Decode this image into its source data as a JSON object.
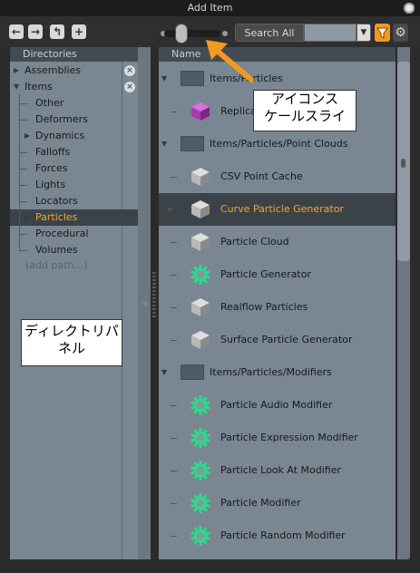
{
  "window": {
    "title": "Add Item"
  },
  "toolbar": {
    "back_icon": "arrow-left",
    "forward_icon": "arrow-right",
    "up_icon": "up-level",
    "add_icon": "plus",
    "search_mode": "Search All",
    "search_value": "",
    "dropdown_icon": "chevron-down",
    "filter_icon": "filter",
    "gear_icon": "gear",
    "filter_color": "#f29a1f"
  },
  "directories": {
    "header": "Directories",
    "items": [
      {
        "label": "Assemblies",
        "level": 0,
        "expander": "collapsed",
        "removable": true,
        "selected": false
      },
      {
        "label": "Items",
        "level": 0,
        "expander": "expanded",
        "removable": true,
        "selected": false
      },
      {
        "label": "Other",
        "level": 1,
        "expander": "none",
        "selected": false
      },
      {
        "label": "Deformers",
        "level": 1,
        "expander": "none",
        "selected": false
      },
      {
        "label": "Dynamics",
        "level": 1,
        "expander": "collapsed",
        "selected": false
      },
      {
        "label": "Falloffs",
        "level": 1,
        "expander": "none",
        "selected": false
      },
      {
        "label": "Forces",
        "level": 1,
        "expander": "none",
        "selected": false
      },
      {
        "label": "Lights",
        "level": 1,
        "expander": "none",
        "selected": false
      },
      {
        "label": "Locators",
        "level": 1,
        "expander": "none",
        "selected": false
      },
      {
        "label": "Particles",
        "level": 1,
        "expander": "collapsed",
        "selected": true
      },
      {
        "label": "Procedural",
        "level": 1,
        "expander": "none",
        "selected": false
      },
      {
        "label": "Volumes",
        "level": 1,
        "expander": "none",
        "selected": false
      }
    ],
    "add_path": "(add path...)"
  },
  "items": {
    "header": "Name",
    "rows": [
      {
        "type": "group",
        "label": "Items/Particles"
      },
      {
        "type": "item",
        "label": "Replicator",
        "icon": "purple-cube-icon",
        "selected": false
      },
      {
        "type": "group",
        "label": "Items/Particles/Point Clouds"
      },
      {
        "type": "item",
        "label": "CSV Point Cache",
        "icon": "gray-cube-icon",
        "selected": false
      },
      {
        "type": "item",
        "label": "Curve Particle Generator",
        "icon": "gray-cube-icon",
        "selected": true
      },
      {
        "type": "item",
        "label": "Particle Cloud",
        "icon": "gray-cube-icon",
        "selected": false
      },
      {
        "type": "item",
        "label": "Particle Generator",
        "icon": "green-gear-icon",
        "selected": false
      },
      {
        "type": "item",
        "label": "Realflow Particles",
        "icon": "gray-cube-icon",
        "selected": false
      },
      {
        "type": "item",
        "label": "Surface Particle Generator",
        "icon": "gray-cube-icon",
        "selected": false
      },
      {
        "type": "group",
        "label": "Items/Particles/Modifiers"
      },
      {
        "type": "item",
        "label": "Particle Audio Modifier",
        "icon": "green-gear-icon",
        "selected": false
      },
      {
        "type": "item",
        "label": "Particle Expression Modifier",
        "icon": "green-gear-icon",
        "selected": false
      },
      {
        "type": "item",
        "label": "Particle Look At Modifier",
        "icon": "green-gear-icon",
        "selected": false
      },
      {
        "type": "item",
        "label": "Particle Modifier",
        "icon": "green-gear-icon",
        "selected": false
      },
      {
        "type": "item",
        "label": "Particle Random Modifier",
        "icon": "green-gear-icon",
        "selected": false
      }
    ]
  },
  "annotations": {
    "icon_scale_slider": [
      "アイコンス",
      "ケールスライ"
    ],
    "directory_panel": [
      "ディレクトリパ",
      "ネル"
    ],
    "arrow_color": "#f29a1f"
  },
  "colors": {
    "selected_text": "#f5a623",
    "panel_bg": "#7a8691",
    "header_bg": "#434c54"
  }
}
